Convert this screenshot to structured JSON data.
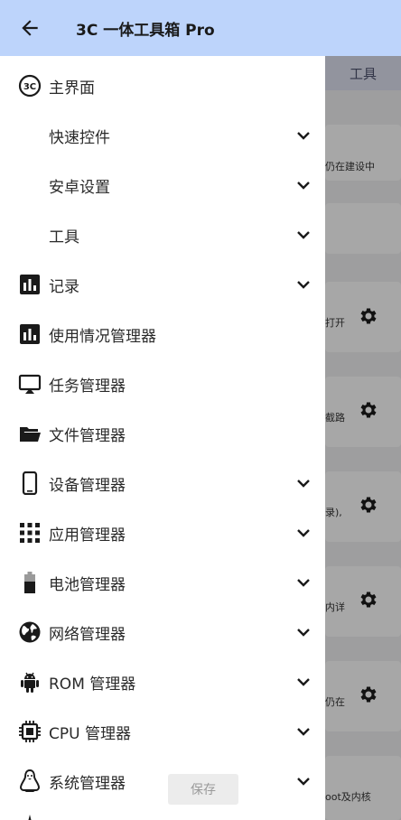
{
  "header": {
    "title": "3C 一体工具箱 Pro"
  },
  "background": {
    "tab_label": "工具",
    "snippets": [
      "仍在建设中",
      "打开",
      "截路",
      "录),",
      "内详",
      "仍在",
      "oot及内核"
    ]
  },
  "drawer": {
    "items": [
      {
        "label": "主界面"
      },
      {
        "label": "快速控件"
      },
      {
        "label": "安卓设置"
      },
      {
        "label": "工具"
      },
      {
        "label": "记录"
      },
      {
        "label": "使用情况管理器"
      },
      {
        "label": "任务管理器"
      },
      {
        "label": "文件管理器"
      },
      {
        "label": "设备管理器"
      },
      {
        "label": "应用管理器"
      },
      {
        "label": "电池管理器"
      },
      {
        "label": "网络管理器"
      },
      {
        "label": "ROM 管理器"
      },
      {
        "label": "CPU 管理器"
      },
      {
        "label": "系统管理器"
      }
    ]
  },
  "footer": {
    "save_label": "保存"
  },
  "icons": [
    "back-arrow-icon",
    "3c-logo-icon",
    "chevron-down-icon",
    "chart-icon",
    "cast-icon",
    "folder-open-icon",
    "phone-icon",
    "grid-icon",
    "battery-icon",
    "globe-icon",
    "android-icon",
    "chip-icon",
    "penguin-icon",
    "gear-icon"
  ]
}
